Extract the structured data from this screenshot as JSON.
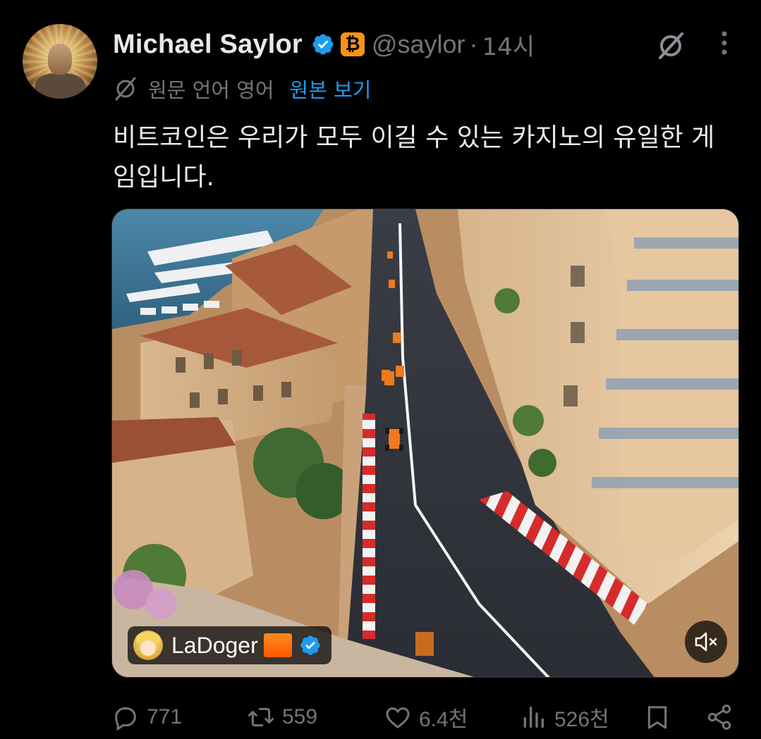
{
  "author": {
    "name": "Michael Saylor",
    "handle": "@saylor",
    "separator": "·",
    "time": "14시",
    "verified": true,
    "badge_symbol": "₿",
    "badge_color": "#f7931a"
  },
  "translation": {
    "original_language": "원문 언어 영어",
    "view_original_label": "원본 보기"
  },
  "tweet": {
    "text": "비트코인은 우리가 모두 이길 수 있는 카지노의 유일한 게임입니다."
  },
  "media": {
    "tag_name": "LaDoger",
    "tag_verified": true,
    "muted": true
  },
  "actions": {
    "reply_count": "771",
    "retweet_count": "559",
    "like_count": "6.4천",
    "view_count": "526천"
  },
  "colors": {
    "background": "#000000",
    "text": "#e7e9ea",
    "muted_text": "#71767b",
    "accent": "#1d9bf0"
  },
  "icons": [
    "grok-icon",
    "more-icon",
    "verified-icon",
    "bitcoin-badge-icon",
    "reply-icon",
    "retweet-icon",
    "like-icon",
    "views-icon",
    "bookmark-icon",
    "share-icon",
    "mute-icon"
  ]
}
